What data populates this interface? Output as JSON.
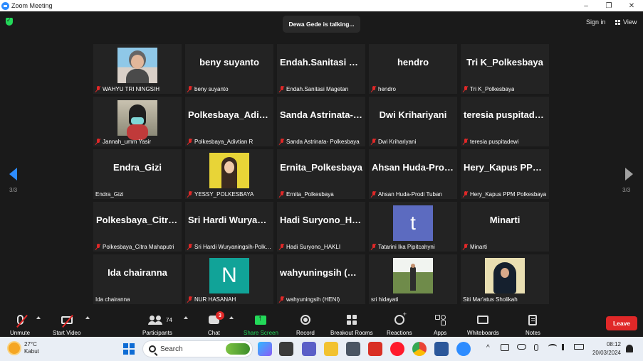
{
  "window": {
    "title": "Zoom Meeting",
    "minimize": "–",
    "maximize": "❐",
    "close": "✕"
  },
  "meeting": {
    "talking": "Dewa Gede is talking...",
    "sign_in": "Sign in",
    "view": "View",
    "page_indicator": "3/3"
  },
  "tiles": [
    {
      "label": "WAHYU TRI NINGSIH",
      "muted": true,
      "photo": "woman-glasses"
    },
    {
      "label": "beny suyanto",
      "muted": true,
      "big": "beny suyanto"
    },
    {
      "label": "Endah.Sanitasi Magetan",
      "muted": true,
      "big": "Endah.Sanitasi Magetan"
    },
    {
      "label": "hendro",
      "muted": true,
      "big": "hendro"
    },
    {
      "label": "Tri K_Polkesbaya",
      "muted": true,
      "big": "Tri K_Polkesbaya"
    },
    {
      "label": "Jannah_umm Yasir",
      "muted": true,
      "photo": "woman-mask"
    },
    {
      "label": "Polkesbaya_Adivtian R",
      "muted": true,
      "big": "Polkesbaya_Adivtian R"
    },
    {
      "label": "Sanda Astrinata- Polkesbaya",
      "muted": true,
      "big": "Sanda Astrinata- Polkesbaya"
    },
    {
      "label": "Dwi Krihariyani",
      "muted": true,
      "big": "Dwi Krihariyani"
    },
    {
      "label": "teresia puspitadewi",
      "muted": true,
      "big": "teresia puspitadewi"
    },
    {
      "label": "Endra_Gizi",
      "muted": false,
      "big": "Endra_Gizi"
    },
    {
      "label": "YESSY_POLKESBAYA",
      "muted": true,
      "photo": "woman-yellow"
    },
    {
      "label": "Ernita_Polkesbaya",
      "muted": true,
      "big": "Ernita_Polkesbaya"
    },
    {
      "label": "Ahsan Huda-Prodi Tuban",
      "muted": true,
      "big": "Ahsan Huda-Prodi Tuban"
    },
    {
      "label": "Hery_Kapus PPM Polkesbaya",
      "muted": true,
      "big": "Hery_Kapus PPM Polkesbaya"
    },
    {
      "label": "Polkesbaya_Citra Mahaputri",
      "muted": true,
      "big": "Polkesbaya_Citra Mahaputri"
    },
    {
      "label": "Sri Hardi Wuryaningsih-Polkesbaya",
      "muted": true,
      "big": "Sri Hardi Wuryaningsih"
    },
    {
      "label": "Hadi Suryono_HAKLI",
      "muted": true,
      "big": "Hadi Suryono_HAKLI"
    },
    {
      "label": "Tatarini Ika Pipitcahyni",
      "muted": true,
      "avatar_letter": "t",
      "avatar_color": "#5c6bc0"
    },
    {
      "label": "Minarti",
      "muted": true,
      "big": "Minarti"
    },
    {
      "label": "Ida chairanna",
      "muted": false,
      "big": "Ida chairanna"
    },
    {
      "label": "NUR HASANAH",
      "muted": true,
      "avatar_letter": "N",
      "avatar_color": "#11a398"
    },
    {
      "label": "wahyuningsih (HENI)",
      "muted": true,
      "big": "wahyuningsih (HENI)"
    },
    {
      "label": "sri hidayati",
      "muted": false,
      "photo": "garden"
    },
    {
      "label": "Siti Mar'atus Sholikah",
      "muted": false,
      "photo": "woman-hijab"
    }
  ],
  "toolbar": {
    "unmute": "Unmute",
    "start_video": "Start Video",
    "participants": "Participants",
    "participants_count": "74",
    "chat": "Chat",
    "chat_badge": "3",
    "share_screen": "Share Screen",
    "record": "Record",
    "breakout_rooms": "Breakout Rooms",
    "reactions": "Reactions",
    "apps": "Apps",
    "whiteboards": "Whiteboards",
    "notes": "Notes",
    "leave": "Leave"
  },
  "taskbar": {
    "weather_temp": "27°C",
    "weather_desc": "Kabut",
    "search_placeholder": "Search",
    "tray_chevron": "^",
    "time": "08:12",
    "date": "20/03/2024"
  },
  "colors": {
    "accent": "#2d8cff",
    "mute_red": "#e02828",
    "share_green": "#23d959",
    "leave_red": "#e02828"
  }
}
